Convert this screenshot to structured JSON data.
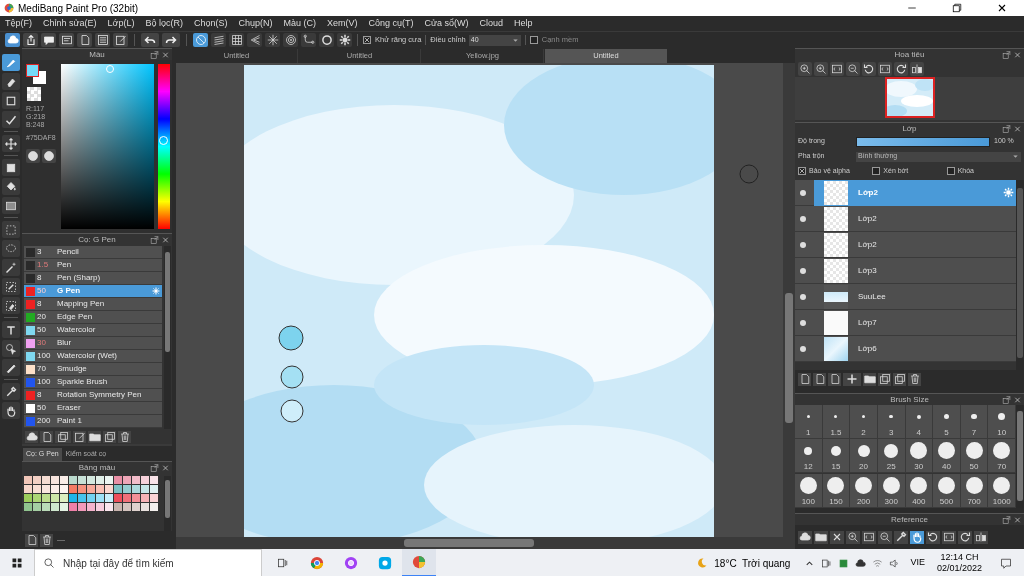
{
  "window": {
    "title": "MediBang Paint Pro (32bit)"
  },
  "menu": [
    "Tệp(F)",
    "Chỉnh sửa(E)",
    "Lớp(L)",
    "Bộ lọc(R)",
    "Chọn(S)",
    "Chụp(N)",
    "Màu (C)",
    "Xem(V)",
    "Công cụ(T)",
    "Cửa sổ(W)",
    "Cloud",
    "Help"
  ],
  "toolbar": {
    "snaps": [
      {
        "kind": "nosnap",
        "selected": true
      },
      {
        "kind": "parallel",
        "selected": false
      },
      {
        "kind": "grid",
        "selected": false
      },
      {
        "kind": "perspective",
        "selected": false
      },
      {
        "kind": "radial",
        "selected": false
      },
      {
        "kind": "concentric",
        "selected": false
      },
      {
        "kind": "curve",
        "selected": false
      },
      {
        "kind": "circle",
        "selected": false
      },
      {
        "kind": "gear",
        "selected": false
      }
    ],
    "antialias": {
      "label": "Khử răng cưa",
      "checked": true
    },
    "correction": {
      "label": "Điều chỉnh",
      "value": "40"
    },
    "soft_edge": {
      "label": "Cạnh mềm",
      "checked": false
    }
  },
  "tools": [
    {
      "kind": "brush",
      "selected": true
    },
    {
      "kind": "eraser",
      "selected": false
    },
    {
      "kind": "dotsquare",
      "selected": false
    },
    {
      "kind": "check",
      "selected": false
    },
    {
      "kind": "move",
      "selected": false
    },
    {
      "kind": "square",
      "selected": false
    },
    {
      "kind": "bucket",
      "selected": false
    },
    {
      "kind": "gradient",
      "selected": false
    },
    {
      "kind": "dashed",
      "selected": false
    },
    {
      "kind": "lasso",
      "selected": false
    },
    {
      "kind": "wand",
      "selected": false
    },
    {
      "kind": "selpen",
      "selected": false
    },
    {
      "kind": "seleraser",
      "selected": false
    },
    {
      "kind": "text",
      "selected": false
    },
    {
      "kind": "pointer",
      "selected": false
    },
    {
      "kind": "pen",
      "selected": false
    },
    {
      "kind": "dropper",
      "selected": false
    },
    {
      "kind": "hand",
      "selected": false
    }
  ],
  "color_panel": {
    "title": "Màu",
    "color": "#75daf8",
    "rgb": [
      "R:117",
      "G:218",
      "B:248"
    ],
    "hex": "#75DAF8"
  },
  "brush_panel": {
    "title": "Cọ: G Pen",
    "brushes": [
      {
        "size": "3",
        "name": "Pencil",
        "color": "#2a2a2a",
        "size_highlighted": false,
        "selected": false
      },
      {
        "size": "1.5",
        "name": "Pen",
        "color": "#2a2a2a",
        "size_highlighted": true,
        "selected": false
      },
      {
        "size": "8",
        "name": "Pen (Sharp)",
        "color": "#2a2a2a",
        "size_highlighted": false,
        "selected": false
      },
      {
        "size": "50",
        "name": "G Pen",
        "color": "#ee2222",
        "size_highlighted": true,
        "selected": true
      },
      {
        "size": "8",
        "name": "Mapping Pen",
        "color": "#ee2222",
        "size_highlighted": false,
        "selected": false
      },
      {
        "size": "20",
        "name": "Edge Pen",
        "color": "#22aa22",
        "size_highlighted": false,
        "selected": false
      },
      {
        "size": "50",
        "name": "Watercolor",
        "color": "#7fd8f0",
        "size_highlighted": false,
        "selected": false
      },
      {
        "size": "30",
        "name": "Blur",
        "color": "#f0a0f0",
        "size_highlighted": true,
        "selected": false
      },
      {
        "size": "100",
        "name": "Watercolor (Wet)",
        "color": "#7fd8f0",
        "size_highlighted": false,
        "selected": false
      },
      {
        "size": "70",
        "name": "Smudge",
        "color": "#fde0c8",
        "size_highlighted": false,
        "selected": false
      },
      {
        "size": "100",
        "name": "Sparkle Brush",
        "color": "#2255ee",
        "size_highlighted": false,
        "selected": false
      },
      {
        "size": "8",
        "name": "Rotation Symmetry Pen",
        "color": "#ee2222",
        "size_highlighted": false,
        "selected": false
      },
      {
        "size": "50",
        "name": "Eraser",
        "color": "#ffffff",
        "size_highlighted": false,
        "selected": false
      },
      {
        "size": "200",
        "name": "Paint 1",
        "color": "#2255ee",
        "size_highlighted": false,
        "selected": false
      }
    ]
  },
  "panel_tabs": [
    {
      "label": "Cọ: G Pen",
      "selected": true
    },
    {
      "label": "Kiểm soát cọ",
      "selected": false
    }
  ],
  "palette_panel": {
    "title": "Bảng màu",
    "swatches": [
      {
        "color": "#f1c6b8"
      },
      {
        "color": "#f3d0c4"
      },
      {
        "color": "#f5dcd2"
      },
      {
        "color": "#f7e4dd"
      },
      {
        "color": "#f9ede8"
      },
      {
        "color": "#b9d9cc"
      },
      {
        "color": "#c7e1d6"
      },
      {
        "color": "#d4e8df"
      },
      {
        "color": "#e0efe8"
      },
      {
        "color": "#ebf5f1"
      },
      {
        "color": "#e98fa5"
      },
      {
        "color": "#eea6b7"
      },
      {
        "color": "#f2bcc9"
      },
      {
        "color": "#f6d1da"
      },
      {
        "color": "#f9e3e9"
      },
      {
        "color": "#f6d5c9"
      },
      {
        "color": "#f8ddd3"
      },
      {
        "color": "#f9e5de"
      },
      {
        "color": "#fbede8"
      },
      {
        "color": "#fdf5f2"
      },
      {
        "color": "#f37a63"
      },
      {
        "color": "#f5917e"
      },
      {
        "color": "#f7a99a"
      },
      {
        "color": "#f9c0b5"
      },
      {
        "color": "#fbd7cf"
      },
      {
        "color": "#7cc1c4"
      },
      {
        "color": "#95cdd0"
      },
      {
        "color": "#add9dc"
      },
      {
        "color": "#c6e5e7"
      },
      {
        "color": "#dff1f2"
      },
      {
        "color": "#9ccd5c"
      },
      {
        "color": "#acd575"
      },
      {
        "color": "#bddd8e"
      },
      {
        "color": "#cde6a7"
      },
      {
        "color": "#ddeec0"
      },
      {
        "color": "#1cb5e8"
      },
      {
        "color": "#47c4ed"
      },
      {
        "color": "#72d2f1"
      },
      {
        "color": "#9ce1f6"
      },
      {
        "color": "#c7effa"
      },
      {
        "color": "#ee4f5b"
      },
      {
        "color": "#f17079"
      },
      {
        "color": "#f49198"
      },
      {
        "color": "#f7b2b6"
      },
      {
        "color": "#fad3d5"
      },
      {
        "color": "#90c48e"
      },
      {
        "color": "#a5cfa3"
      },
      {
        "color": "#badbb8"
      },
      {
        "color": "#cfe7cd"
      },
      {
        "color": "#e4f3e3"
      },
      {
        "color": "#f080a8"
      },
      {
        "color": "#f39aba"
      },
      {
        "color": "#f5b3cc"
      },
      {
        "color": "#f8cddd"
      },
      {
        "color": "#fbe6ee"
      },
      {
        "color": "#c9b4ae"
      },
      {
        "color": "#d4c3be"
      },
      {
        "color": "#dfd2ce"
      },
      {
        "color": "#e9e1de"
      },
      {
        "color": "#f4f0ee"
      }
    ],
    "footer": "—"
  },
  "document_tabs": [
    {
      "label": "Untitled",
      "selected": false
    },
    {
      "label": "Untitled",
      "selected": false
    },
    {
      "label": "Yellow.jpg",
      "selected": false
    },
    {
      "label": "Untitled",
      "selected": true
    }
  ],
  "navigator": {
    "title": "Hoa tiêu"
  },
  "layers": {
    "title": "Lớp",
    "opacity": {
      "label": "Độ trong",
      "level": 1,
      "reading": "100 %"
    },
    "blend": {
      "label": "Pha trộn",
      "value": "Bình thường"
    },
    "options": [
      {
        "label": "Bảo vệ alpha",
        "checked": true
      },
      {
        "label": "Xén bớt",
        "checked": false
      },
      {
        "label": "Khóa",
        "checked": false
      }
    ],
    "items": [
      {
        "name": "Lớp2",
        "kind": "transparent",
        "selected": true
      },
      {
        "name": "Lớp2",
        "kind": "transparent",
        "selected": false
      },
      {
        "name": "Lớp2",
        "kind": "transparent",
        "selected": false
      },
      {
        "name": "Lớp3",
        "kind": "transparent",
        "selected": false
      },
      {
        "name": "SuuLee",
        "kind": "band",
        "selected": false
      },
      {
        "name": "Lớp7",
        "kind": "white",
        "selected": false
      },
      {
        "name": "Lớp6",
        "kind": "sky",
        "selected": false
      }
    ]
  },
  "brush_size": {
    "title": "Brush Size",
    "sizes": [
      "1",
      "1.5",
      "2",
      "3",
      "4",
      "5",
      "7",
      "10",
      "12",
      "15",
      "20",
      "25",
      "30",
      "40",
      "50",
      "70",
      "100",
      "150",
      "200",
      "300",
      "400",
      "500",
      "700",
      "1000"
    ]
  },
  "reference": {
    "title": "Reference"
  },
  "taskbar": {
    "search_placeholder": "Nhập tại đây để tìm kiếm",
    "weather": "18°C  Trời quang",
    "language": "VIE",
    "time": "12:14 CH",
    "date": "02/01/2022"
  }
}
